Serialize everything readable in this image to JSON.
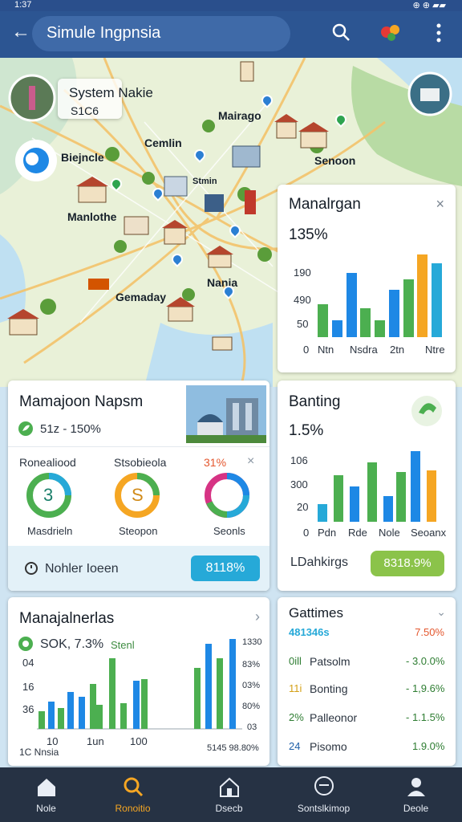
{
  "status_bar": {
    "time": "1:37",
    "icons": "✉ ⊕ ⚠",
    "right": "⊕ ⊕ ▰▰"
  },
  "app_bar": {
    "search_text": "Simule Ingpnsia",
    "back_icon": "back-arrow-icon",
    "search_icon": "search-icon",
    "menu_icon": "more-vert-icon"
  },
  "map": {
    "labels": [
      "System Nakie",
      "S1C6",
      "Mairago",
      "Cemlin",
      "Biejncle",
      "Senoon",
      "Manlothe",
      "Stmin",
      "Nania",
      "Gemaday"
    ]
  },
  "manalrgan": {
    "title": "Manalrgan",
    "value": "135%",
    "yticks": [
      "190",
      "490",
      "50",
      "0"
    ],
    "xticks": [
      "Ntn",
      "Nsdra",
      "2tn",
      "Ntre"
    ],
    "bars": [
      {
        "v": 0.3,
        "c": "#4caf50"
      },
      {
        "v": 0.15,
        "c": "#1e88e5"
      },
      {
        "v": 0.58,
        "c": "#1e88e5"
      },
      {
        "v": 0.26,
        "c": "#4caf50"
      },
      {
        "v": 0.15,
        "c": "#4caf50"
      },
      {
        "v": 0.43,
        "c": "#1e88e5"
      },
      {
        "v": 0.52,
        "c": "#4caf50"
      },
      {
        "v": 0.75,
        "c": "#f5a623"
      },
      {
        "v": 0.67,
        "c": "#26a9d8"
      }
    ]
  },
  "majnapsn": {
    "title": "Mamajoon Napsm",
    "stat": "51z - 150%",
    "gauges": [
      {
        "label": "Ronealiood",
        "value": "3",
        "caption": "Masdrieln"
      },
      {
        "label": "Stsobieola",
        "value": "S",
        "caption": "Steopon"
      },
      {
        "label": "31%",
        "value": "",
        "caption": "Seonls"
      }
    ],
    "cta_label": "Nohler Ioeen",
    "cta_value": "8118%"
  },
  "banting": {
    "title": "Banting",
    "value": "1.5%",
    "yticks": [
      "106",
      "300",
      "20",
      "0"
    ],
    "xticks": [
      "Pdn",
      "Rde",
      "Nole",
      "Seoanx"
    ],
    "cta_label": "LDahkirgs",
    "cta_value": "8318.9%"
  },
  "manajalnerlas": {
    "title": "Manajalnerlas",
    "stat": "SOK, 7.3%",
    "stat_extra": "Stenl",
    "yleft": [
      "04",
      "16",
      "36"
    ],
    "yright": [
      "1330",
      "83%",
      "03%",
      "80%",
      "03"
    ],
    "xticks": [
      "10",
      "1un",
      "100"
    ],
    "foot_left": "1C Nnsia",
    "foot_right": "5145 98.80%"
  },
  "gattimes": {
    "title": "Gattimes",
    "header_left": "481346s",
    "header_right": "7.50%",
    "rows": [
      {
        "name": "Patsolm",
        "id": "0ill",
        "value": "- 3.0.0%"
      },
      {
        "name": "Bonting",
        "id": "11i",
        "value": "- 1,9.6%"
      },
      {
        "name": "Palleonor",
        "id": "2%",
        "value": "- 1.1.5%"
      },
      {
        "name": "Pisomo",
        "id": "24",
        "value": "1.9.0%"
      }
    ]
  },
  "nav": [
    {
      "label": "Nole",
      "icon": "home-icon"
    },
    {
      "label": "Ronoitio",
      "icon": "search-icon"
    },
    {
      "label": "Dsecb",
      "icon": "house-icon"
    },
    {
      "label": "Sontslkimop",
      "icon": "chat-icon"
    },
    {
      "label": "Deole",
      "icon": "person-icon"
    }
  ],
  "colors": {
    "primary": "#2c5592",
    "accent": "#f5a623",
    "green": "#4caf50",
    "blue": "#1e88e5",
    "teal": "#26a9d8"
  }
}
